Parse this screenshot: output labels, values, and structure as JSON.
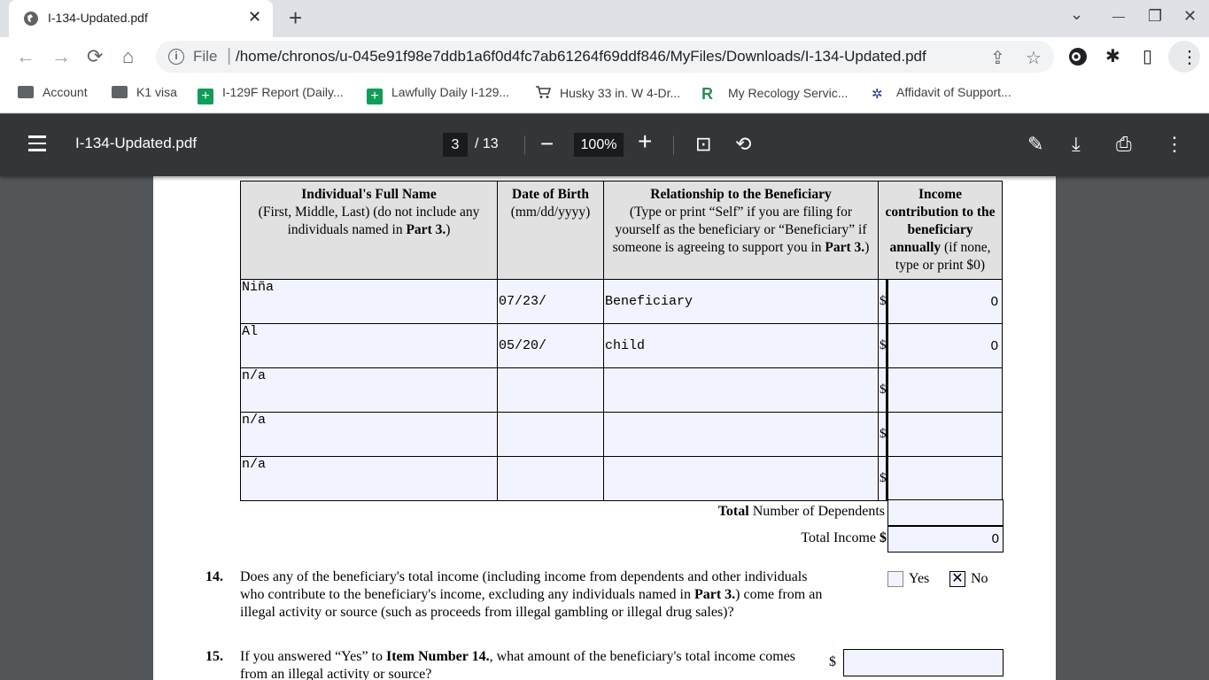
{
  "tab": {
    "title": "I-134-Updated.pdf",
    "close": "✕",
    "new_tab": "+"
  },
  "window": {
    "chevron": "⌄",
    "minimize": "—",
    "restore": "❐",
    "close": "✕"
  },
  "toolbar": {
    "back": "←",
    "forward": "→",
    "reload": "⟳",
    "home": "⌂",
    "url_scheme": "File",
    "url": "/home/chronos/u-045e91f98e7ddb1a6f0d4fc7ab61264f69ddf846/MyFiles/Downloads/I-134-Updated.pdf",
    "share": "⇪",
    "star": "☆",
    "extensions": "✱",
    "sidepanel": "▯",
    "more": "⋮"
  },
  "bookmarks": [
    {
      "label": "Account",
      "icon": "folder-icon"
    },
    {
      "label": "K1 visa",
      "icon": "folder-icon"
    },
    {
      "label": "I-129F Report (Daily...",
      "icon": "sheets-icon"
    },
    {
      "label": "Lawfully Daily I-129...",
      "icon": "sheets-icon"
    },
    {
      "label": "Husky 33 in. W 4-Dr...",
      "icon": "cart-icon"
    },
    {
      "label": "My Recology Servic...",
      "icon": "recology-icon"
    },
    {
      "label": "Affidavit of Support...",
      "icon": "uscis-icon"
    }
  ],
  "pdf_viewer": {
    "title": "I-134-Updated.pdf",
    "page_current": "3",
    "page_total": "/ 13",
    "zoom": "100%",
    "zoom_out": "−",
    "zoom_in": "+",
    "fit": "⊡",
    "rotate": "⟲",
    "annotate": "✎",
    "download": "⤓",
    "print": "⎙",
    "more": "⋮"
  },
  "dependents_table": {
    "headers": {
      "name_title": "Individual's Full Name",
      "name_sub_a": "(First, Middle, Last) (do not include any individuals named in ",
      "name_sub_b": "Part 3.",
      "name_sub_c": ")",
      "dob_title": "Date of Birth",
      "dob_sub": "(mm/dd/yyyy)",
      "rel_title": "Relationship to the Beneficiary",
      "rel_sub": "(Type or print “Self” if you are filing for yourself as the beneficiary or “Beneficiary” if someone is agreeing to support you in ",
      "rel_sub_b": "Part 3.",
      "rel_sub_c": ")",
      "inc_title": "Income contribution to the beneficiary annually",
      "inc_sub": " (if none, type or print $0)"
    },
    "rows": [
      {
        "name": "Niña",
        "dob": "07/23/",
        "relationship": "Beneficiary",
        "dollar": "$",
        "income": "0"
      },
      {
        "name": "Al",
        "dob": "05/20/",
        "relationship": "child",
        "dollar": "$",
        "income": "0"
      },
      {
        "name": "n/a",
        "dob": "",
        "relationship": "",
        "dollar": "$",
        "income": ""
      },
      {
        "name": "n/a",
        "dob": "",
        "relationship": "",
        "dollar": "$",
        "income": ""
      },
      {
        "name": "n/a",
        "dob": "",
        "relationship": "",
        "dollar": "$",
        "income": ""
      }
    ]
  },
  "totals": {
    "dependents_bold": "Total",
    "dependents_rest": " Number of Dependents",
    "dependents_value": "",
    "income_label": "Total Income ",
    "income_dollar": "$",
    "income_value": "0"
  },
  "q14": {
    "number": "14.",
    "text_a": "Does any of the beneficiary's total income (including income from dependents and other individuals who contribute to the beneficiary's income, excluding any individuals named in ",
    "text_bold": "Part 3.",
    "text_b": ") come from an illegal activity or source (such as proceeds from illegal gambling or illegal drug sales)?",
    "yes_label": "Yes",
    "yes_mark": "",
    "no_label": "No",
    "no_mark": "✕"
  },
  "q15": {
    "number": "15.",
    "text_a": "If you answered “Yes” to ",
    "text_bold": "Item Number 14.",
    "text_b": ", what amount of the beneficiary's total income comes from an illegal activity or source?",
    "dollar": "$",
    "value": ""
  }
}
